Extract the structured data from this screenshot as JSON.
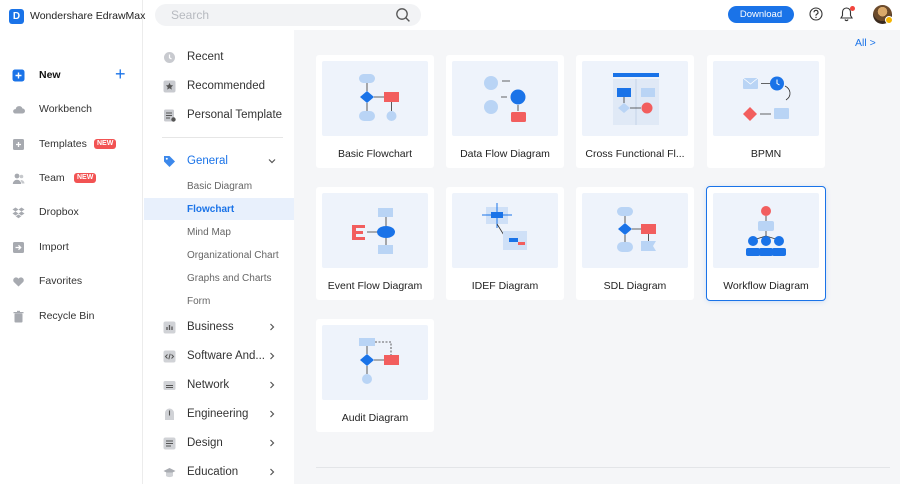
{
  "app": {
    "title": "Wondershare EdrawMax",
    "logo_letter": "D"
  },
  "leftnav": {
    "new_label": "New",
    "items": [
      {
        "label": "Workbench",
        "icon": "cloud-icon"
      },
      {
        "label": "Templates",
        "icon": "templates-icon",
        "badge": "NEW"
      },
      {
        "label": "Team",
        "icon": "team-icon",
        "badge": "NEW"
      },
      {
        "label": "Dropbox",
        "icon": "dropbox-icon"
      },
      {
        "label": "Import",
        "icon": "import-icon"
      },
      {
        "label": "Favorites",
        "icon": "heart-icon"
      },
      {
        "label": "Recycle Bin",
        "icon": "trash-icon"
      }
    ]
  },
  "topbar": {
    "search_placeholder": "Search",
    "download_label": "Download"
  },
  "categories": {
    "recent": "Recent",
    "recommended": "Recommended",
    "personal": "Personal Template",
    "general": "General",
    "general_sub": [
      "Basic Diagram",
      "Flowchart",
      "Mind Map",
      "Organizational Chart",
      "Graphs and Charts",
      "Form"
    ],
    "active_sub": "Flowchart",
    "others": [
      "Business",
      "Software And...",
      "Network",
      "Engineering",
      "Design",
      "Education"
    ]
  },
  "content": {
    "all_link": "All >",
    "cards": [
      {
        "label": "Basic Flowchart"
      },
      {
        "label": "Data Flow Diagram"
      },
      {
        "label": "Cross Functional Fl..."
      },
      {
        "label": "BPMN"
      },
      {
        "label": "Event Flow Diagram"
      },
      {
        "label": "IDEF Diagram"
      },
      {
        "label": "SDL Diagram"
      },
      {
        "label": "Workflow Diagram",
        "selected": true
      },
      {
        "label": "Audit Diagram"
      }
    ]
  },
  "colors": {
    "accent": "#1a73e8",
    "badge": "#f25353",
    "shape_light": "#b9d4f5",
    "shape_red": "#f25e5e"
  }
}
